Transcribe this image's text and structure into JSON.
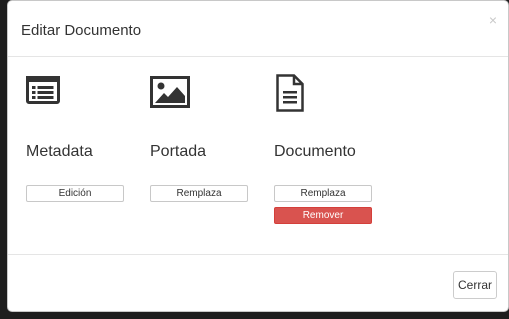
{
  "modal": {
    "title": "Editar Documento",
    "close_symbol": "×"
  },
  "sections": {
    "metadata": {
      "label": "Metadata",
      "icon": "list-alt-icon",
      "edit_label": "Edición"
    },
    "portada": {
      "label": "Portada",
      "icon": "image-icon",
      "replace_label": "Remplaza"
    },
    "documento": {
      "label": "Documento",
      "icon": "file-text-icon",
      "replace_label": "Remplaza",
      "remove_label": "Remover"
    }
  },
  "footer": {
    "close_label": "Cerrar"
  },
  "colors": {
    "danger": "#d9534f",
    "icon": "#333333",
    "backdrop": "#1e1e1e"
  }
}
